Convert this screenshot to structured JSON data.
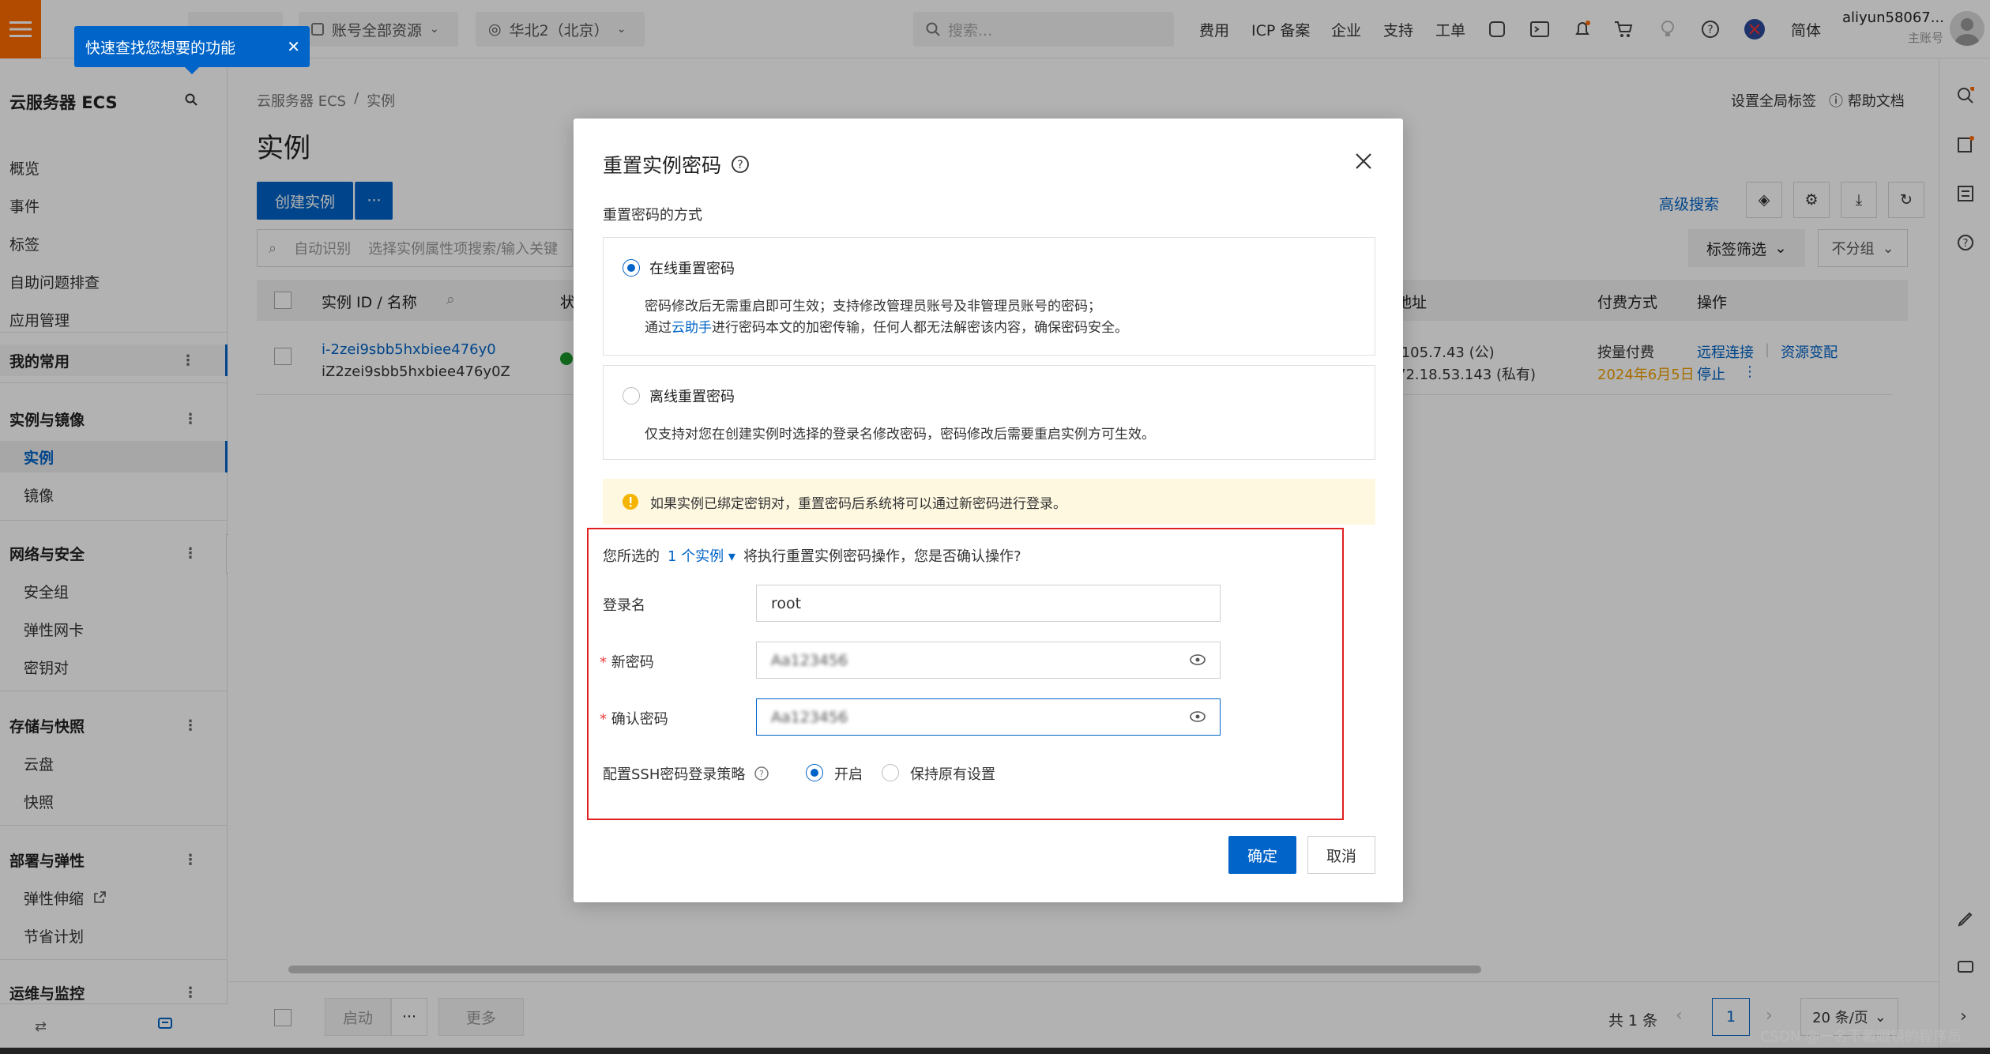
{
  "topbar": {
    "workspace_label": "账号全部资源",
    "region_label": "华北2（北京）",
    "search_placeholder": "搜索...",
    "links": [
      "费用",
      "ICP 备案",
      "企业",
      "支持",
      "工单"
    ],
    "language": "简体",
    "account_name": "aliyun58067...",
    "account_role": "主账号"
  },
  "tooltip": {
    "text": "快速查找您想要的功能"
  },
  "sidebar": {
    "title": "云服务器 ECS",
    "top_items": [
      "概览",
      "事件",
      "标签",
      "自助问题排查",
      "应用管理"
    ],
    "my_common": "我的常用",
    "groups": [
      {
        "label": "实例与镜像",
        "items": [
          "实例",
          "镜像"
        ]
      },
      {
        "label": "网络与安全",
        "items": [
          "安全组",
          "弹性网卡",
          "密钥对"
        ]
      },
      {
        "label": "存储与快照",
        "items": [
          "云盘",
          "快照"
        ]
      },
      {
        "label": "部署与弹性",
        "items": [
          "弹性伸缩",
          "节省计划"
        ]
      },
      {
        "label": "运维与监控",
        "items": []
      }
    ]
  },
  "main": {
    "breadcrumb": [
      "云服务器 ECS",
      "实例"
    ],
    "page_title": "实例",
    "header_links": [
      "设置全局标签",
      "帮助文档"
    ],
    "create_button": "创建实例",
    "more_button": "···",
    "filter_mode": "自动识别",
    "filter_placeholder": "选择实例属性项搜索/输入关键",
    "advanced_search": "高级搜索",
    "tag_filter": "标签筛选",
    "group_select": "不分组",
    "columns": [
      "实例 ID / 名称",
      "状",
      "地址",
      "付费方式",
      "操作"
    ],
    "row": {
      "id": "i-2zei9sbb5hxbiee476y0",
      "name": "iZ2zei9sbb5hxbiee476y0Z",
      "ip_public": ".105.7.43 (公)",
      "ip_private": "72.18.53.143 (私有)",
      "billing": "按量付费",
      "billing_date": "2024年6月5日",
      "actions": [
        "远程连接",
        "资源变配",
        "停止"
      ]
    },
    "footer": {
      "start": "启动",
      "more_dots": "···",
      "more": "更多",
      "total": "共 1 条",
      "page": "1",
      "page_size": "20 条/页"
    }
  },
  "modal": {
    "title": "重置实例密码",
    "method_label": "重置密码的方式",
    "online": {
      "label": "在线重置密码",
      "line1": "密码修改后无需重启即可生效；支持修改管理员账号及非管理员账号的密码；",
      "line2_pre": "通过",
      "line2_link": "云助手",
      "line2_post": "进行密码本文的加密传输，任何人都无法解密该内容，确保密码安全。"
    },
    "offline": {
      "label": "离线重置密码",
      "line1": "仅支持对您在创建实例时选择的登录名修改密码，密码修改后需要重启实例方可生效。"
    },
    "notice": "如果实例已绑定密钥对，重置密码后系统将可以通过新密码进行登录。",
    "confirm_pre": "您所选的",
    "confirm_link": "1 个实例",
    "confirm_post": "将执行重置实例密码操作，您是否确认操作?",
    "login_label": "登录名",
    "login_value": "root",
    "new_pwd_label": "新密码",
    "new_pwd_value": "Aa123456",
    "confirm_pwd_label": "确认密码",
    "confirm_pwd_value": "Aa123456",
    "ssh_label": "配置SSH密码登录策略",
    "ssh_on": "开启",
    "ssh_keep": "保持原有设置",
    "ok": "确定",
    "cancel": "取消"
  },
  "watermark": "CSDN @一名不戴眼镜的程序员",
  "colors": {
    "brand": "#ff6a00",
    "primary": "#0064c8",
    "danger": "#e02020",
    "warning_bg": "#fff8e1"
  }
}
